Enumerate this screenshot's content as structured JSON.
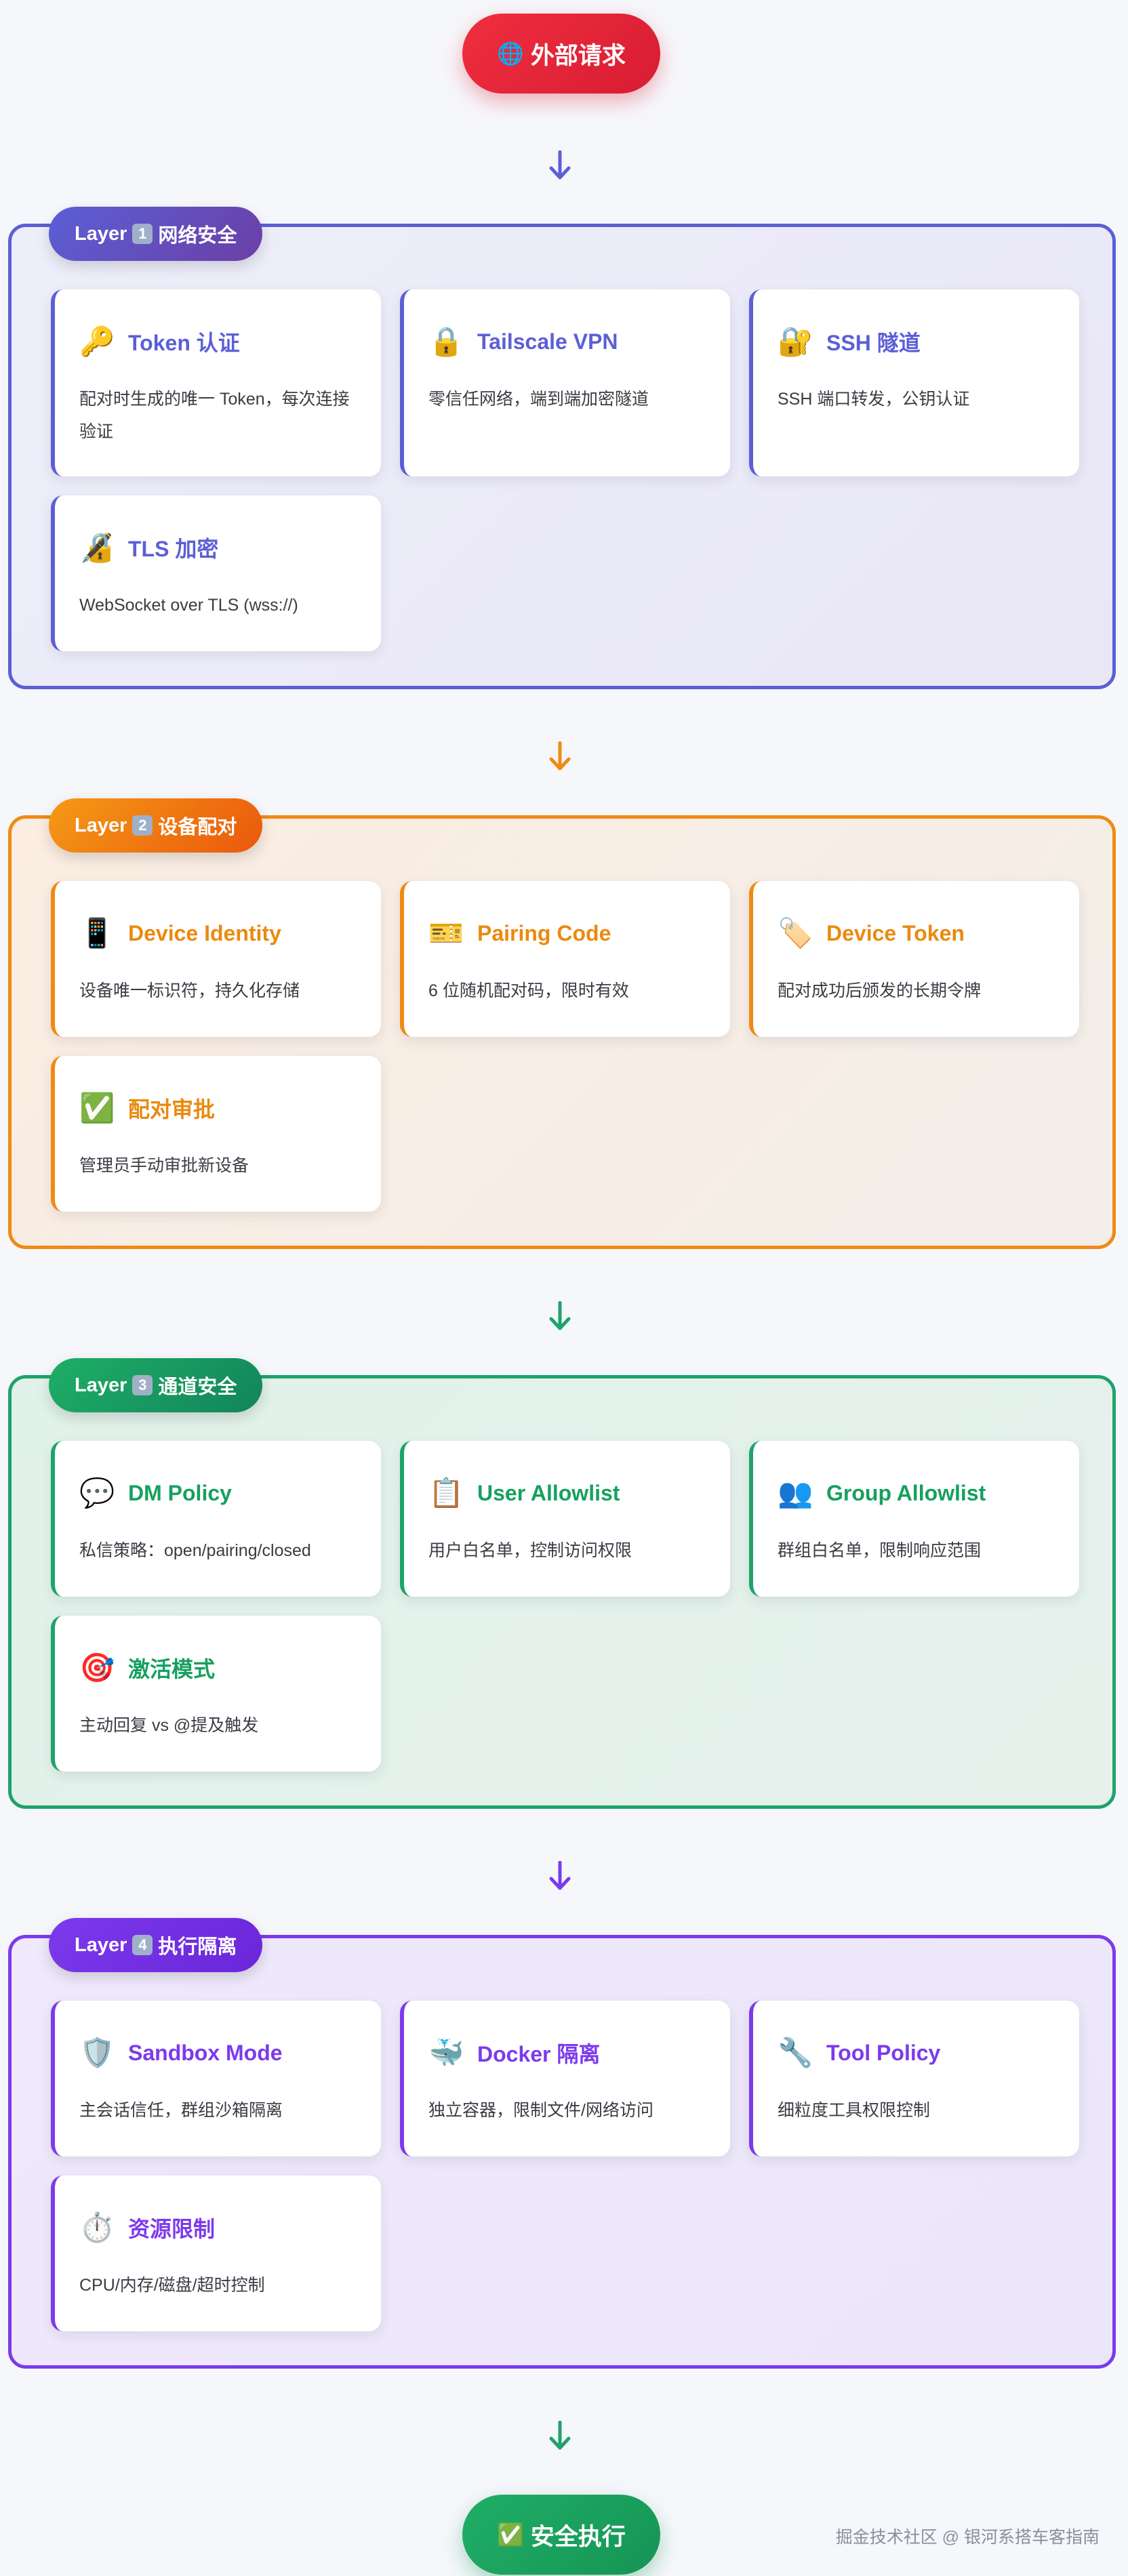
{
  "start": {
    "icon": "🌐",
    "label": "外部请求",
    "color": "#e2263b"
  },
  "end": {
    "icon": "✅",
    "label": "安全执行",
    "color": "#18a05d"
  },
  "layers": [
    {
      "badge": "Layer",
      "number": "1",
      "name": "网络安全",
      "color": "#5b5fd6",
      "cards": [
        {
          "icon": "🔑",
          "icon_name": "key-icon",
          "title": "Token 认证",
          "desc": "配对时生成的唯一 Token，每次连接验证"
        },
        {
          "icon": "🔒",
          "icon_name": "lock-icon",
          "title": "Tailscale VPN",
          "desc": "零信任网络，端到端加密隧道"
        },
        {
          "icon": "🔐",
          "icon_name": "lock-key-icon",
          "title": "SSH 隧道",
          "desc": "SSH 端口转发，公钥认证"
        },
        {
          "icon": "🔏",
          "icon_name": "lock-pen-icon",
          "title": "TLS 加密",
          "desc": "WebSocket over TLS (wss://)"
        }
      ]
    },
    {
      "badge": "Layer",
      "number": "2",
      "name": "设备配对",
      "color": "#f08a14",
      "cards": [
        {
          "icon": "📱",
          "icon_name": "phone-icon",
          "title": "Device Identity",
          "desc": "设备唯一标识符，持久化存储"
        },
        {
          "icon": "🎫",
          "icon_name": "ticket-icon",
          "title": "Pairing Code",
          "desc": "6 位随机配对码，限时有效"
        },
        {
          "icon": "🏷️",
          "icon_name": "tag-icon",
          "title": "Device Token",
          "desc": "配对成功后颁发的长期令牌"
        },
        {
          "icon": "✅",
          "icon_name": "check-icon",
          "title": "配对审批",
          "desc": "管理员手动审批新设备"
        }
      ]
    },
    {
      "badge": "Layer",
      "number": "3",
      "name": "通道安全",
      "color": "#1ea36a",
      "cards": [
        {
          "icon": "💬",
          "icon_name": "chat-bubble-icon",
          "title": "DM Policy",
          "desc": "私信策略：open/pairing/closed"
        },
        {
          "icon": "📋",
          "icon_name": "clipboard-icon",
          "title": "User Allowlist",
          "desc": "用户白名单，控制访问权限"
        },
        {
          "icon": "👥",
          "icon_name": "group-icon",
          "title": "Group Allowlist",
          "desc": "群组白名单，限制响应范围"
        },
        {
          "icon": "🎯",
          "icon_name": "target-icon",
          "title": "激活模式",
          "desc": "主动回复 vs @提及触发"
        }
      ]
    },
    {
      "badge": "Layer",
      "number": "4",
      "name": "执行隔离",
      "color": "#7c3aed",
      "cards": [
        {
          "icon": "🛡️",
          "icon_name": "shield-icon",
          "title": "Sandbox Mode",
          "desc": "主会话信任，群组沙箱隔离"
        },
        {
          "icon": "🐳",
          "icon_name": "whale-icon",
          "title": "Docker 隔离",
          "desc": "独立容器，限制文件/网络访问"
        },
        {
          "icon": "🔧",
          "icon_name": "wrench-icon",
          "title": "Tool Policy",
          "desc": "细粒度工具权限控制"
        },
        {
          "icon": "⏱️",
          "icon_name": "stopwatch-icon",
          "title": "资源限制",
          "desc": "CPU/内存/磁盘/超时控制"
        }
      ]
    }
  ],
  "footer": "掘金技术社区 @ 银河系搭车客指南"
}
